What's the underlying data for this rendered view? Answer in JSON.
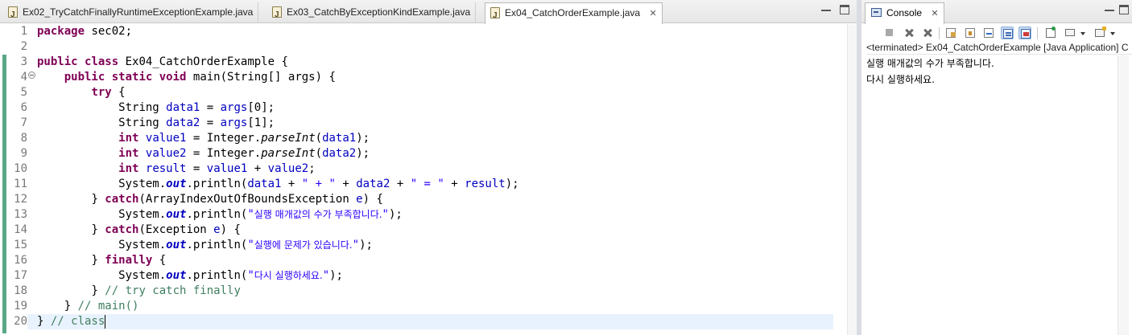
{
  "editor": {
    "tabs": [
      {
        "label": "Ex02_TryCatchFinallyRuntimeExceptionExample.java",
        "active": false,
        "icon": "java-file-icon"
      },
      {
        "label": "Ex03_CatchByExceptionKindExample.java",
        "active": false,
        "icon": "java-file-icon"
      },
      {
        "label": "Ex04_CatchOrderExample.java",
        "active": true,
        "icon": "java-file-icon",
        "close": "✕"
      }
    ],
    "line_numbers": [
      "1",
      "2",
      "3",
      "4",
      "5",
      "6",
      "7",
      "8",
      "9",
      "10",
      "11",
      "12",
      "13",
      "14",
      "15",
      "16",
      "17",
      "18",
      "19",
      "20"
    ],
    "current_line": 20,
    "code": {
      "l1": {
        "kw": "package",
        "rest": " sec02;"
      },
      "l3": {
        "kw1": "public",
        "kw2": "class",
        "rest": " Ex04_CatchOrderExample {"
      },
      "l4": {
        "indent": "    ",
        "kw1": "public",
        "kw2": "static",
        "kw3": "void",
        "rest": " main(String[] args) {"
      },
      "l5": {
        "indent": "        ",
        "kw": "try",
        "rest": " {"
      },
      "l6": {
        "indent": "            ",
        "a": "String ",
        "var": "data1",
        "b": " = ",
        "arr": "args",
        "c": "[0];"
      },
      "l7": {
        "indent": "            ",
        "a": "String ",
        "var": "data2",
        "b": " = ",
        "arr": "args",
        "c": "[1];"
      },
      "l8": {
        "indent": "            ",
        "kw": "int",
        "a": " ",
        "var": "value1",
        "b": " = Integer.",
        "meth": "parseInt",
        "c": "(",
        "arg": "data1",
        "d": ");"
      },
      "l9": {
        "indent": "            ",
        "kw": "int",
        "a": " ",
        "var": "value2",
        "b": " = Integer.",
        "meth": "parseInt",
        "c": "(",
        "arg": "data2",
        "d": ");"
      },
      "l10": {
        "indent": "            ",
        "kw": "int",
        "a": " ",
        "var": "result",
        "b": " = ",
        "v1": "value1",
        "c": " + ",
        "v2": "value2",
        "d": ";"
      },
      "l11": {
        "indent": "            ",
        "a": "System.",
        "out": "out",
        "b": ".println(",
        "v1": "data1",
        "c": " + ",
        "s1": "\" + \"",
        "d": " + ",
        "v2": "data2",
        "e": " + ",
        "s2": "\" = \"",
        "f": " + ",
        "v3": "result",
        "g": ");"
      },
      "l12": {
        "indent": "        ",
        "a": "} ",
        "kw": "catch",
        "b": "(ArrayIndexOutOfBoundsException ",
        "var": "e",
        "c": ") {"
      },
      "l13": {
        "indent": "            ",
        "a": "System.",
        "out": "out",
        "b": ".println(",
        "q1": "\"",
        "ko": "실행 매개값의 수가 부족합니다.",
        "q2": "\"",
        "c": ");"
      },
      "l14": {
        "indent": "        ",
        "a": "} ",
        "kw": "catch",
        "b": "(Exception ",
        "var": "e",
        "c": ") {"
      },
      "l15": {
        "indent": "            ",
        "a": "System.",
        "out": "out",
        "b": ".println(",
        "q1": "\"",
        "ko": "실행에 문제가 있습니다.",
        "q2": "\"",
        "c": ");"
      },
      "l16": {
        "indent": "        ",
        "a": "} ",
        "kw": "finally",
        "b": " {"
      },
      "l17": {
        "indent": "            ",
        "a": "System.",
        "out": "out",
        "b": ".println(",
        "q1": "\"",
        "ko": "다시 실행하세요.",
        "q2": "\"",
        "c": ");"
      },
      "l18": {
        "indent": "        ",
        "a": "} ",
        "cm": "// try catch finally"
      },
      "l19": {
        "indent": "    ",
        "a": "} ",
        "cm": "// main()"
      },
      "l20": {
        "a": "} ",
        "cm": "// class"
      }
    }
  },
  "console": {
    "tab_label": "Console",
    "tab_icon": "console-icon",
    "tab_close": "✕",
    "toolbar_icons": [
      "terminate-icon",
      "remove-launch-icon",
      "remove-all-icon",
      "clear-console-icon",
      "scroll-lock-icon",
      "word-wrap-icon",
      "show-stdout-icon",
      "show-stderr-icon",
      "pin-console-icon",
      "display-console-icon",
      "open-console-icon"
    ],
    "description": "<terminated> Ex04_CatchOrderExample [Java Application] C",
    "output": [
      "실행 매개값의 수가 부족합니다.",
      "다시 실행하세요."
    ]
  },
  "colors": {
    "keyword": "#7f0055",
    "field": "#0000c0",
    "string": "#2a00ff",
    "comment": "#3f7f5f",
    "current_line": "#e8f2fe",
    "change_ruler": "#5aa887"
  }
}
